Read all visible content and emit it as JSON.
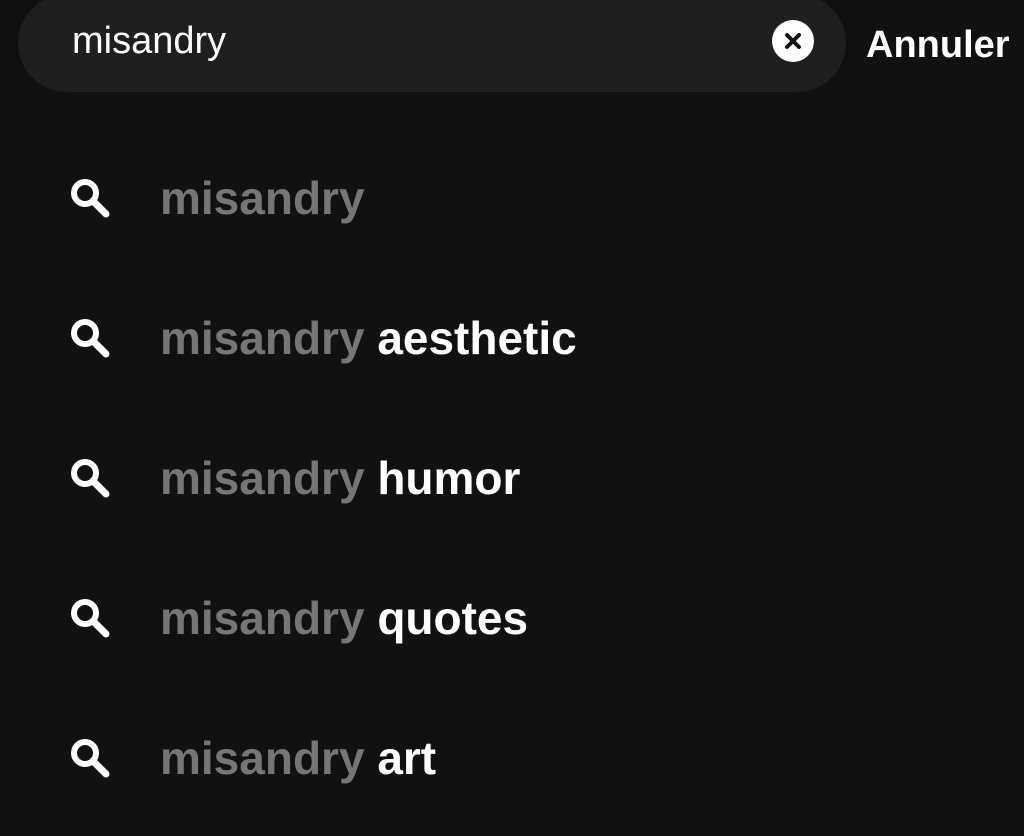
{
  "search": {
    "value": "misandry",
    "clear_icon": "close-circle-icon",
    "cancel_label": "Annuler"
  },
  "colors": {
    "background": "#111111",
    "search_field": "#1f1f1f",
    "query_text": "#767676",
    "completion_text": "#ffffff"
  },
  "suggestions": [
    {
      "icon": "search-icon",
      "query": "misandry",
      "completion": ""
    },
    {
      "icon": "search-icon",
      "query": "misandry",
      "completion": "aesthetic"
    },
    {
      "icon": "search-icon",
      "query": "misandry",
      "completion": "humor"
    },
    {
      "icon": "search-icon",
      "query": "misandry",
      "completion": "quotes"
    },
    {
      "icon": "search-icon",
      "query": "misandry",
      "completion": "art"
    }
  ]
}
